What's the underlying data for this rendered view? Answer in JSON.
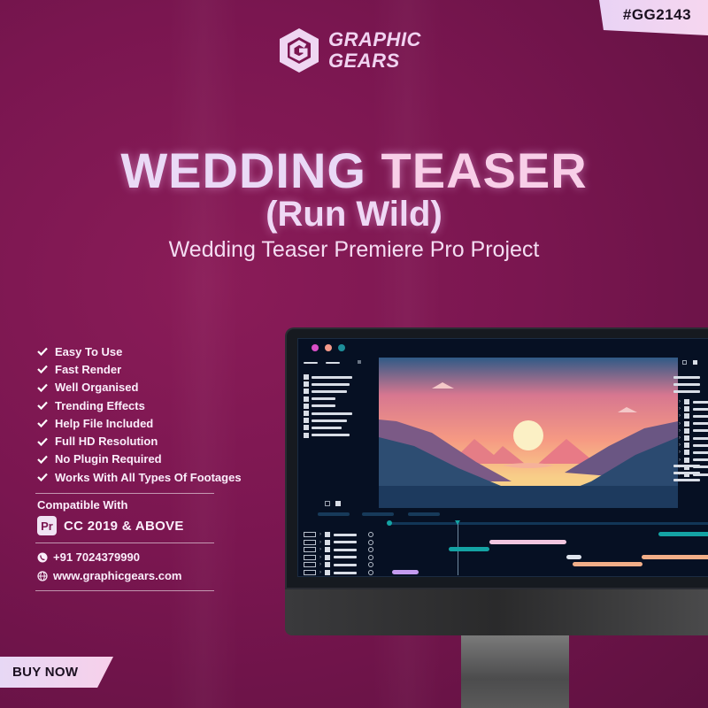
{
  "tag": "#GG2143",
  "logo": {
    "line1": "GRAPHIC",
    "line2": "GEARS",
    "icon": "hexagon-g-logo-icon"
  },
  "title": {
    "part1": "WEDDING ",
    "part2": "TEASER"
  },
  "subtitle": "(Run Wild)",
  "tagline": "Wedding Teaser Premiere Pro Project",
  "features": [
    "Easy To Use",
    "Fast Render",
    "Well Organised",
    "Trending Effects",
    "Help File Included",
    "Full HD Resolution",
    "No Plugin Required",
    "Works With All Types Of Footages"
  ],
  "compatibility": {
    "label": "Compatible With",
    "badge": "Pr",
    "text": "CC 2019 & ABOVE"
  },
  "contact": {
    "phone": "+91 7024379990",
    "website": "www.graphicgears.com"
  },
  "cta": "BUY NOW",
  "colors": {
    "background": "#7a1650",
    "accent_light": "#ead9f6",
    "pink": "#f8cfe8",
    "clip_teal": "#14a3a4",
    "clip_pink": "#f2c6e0",
    "clip_coral": "#e0587a",
    "clip_peach": "#f2ae88",
    "clip_lavender": "#c49bf0",
    "clip_white": "#dfe5ee"
  },
  "editor_mock": {
    "window_dots": [
      "#d94fc8",
      "#f59a8a",
      "#1d8e9a"
    ]
  }
}
